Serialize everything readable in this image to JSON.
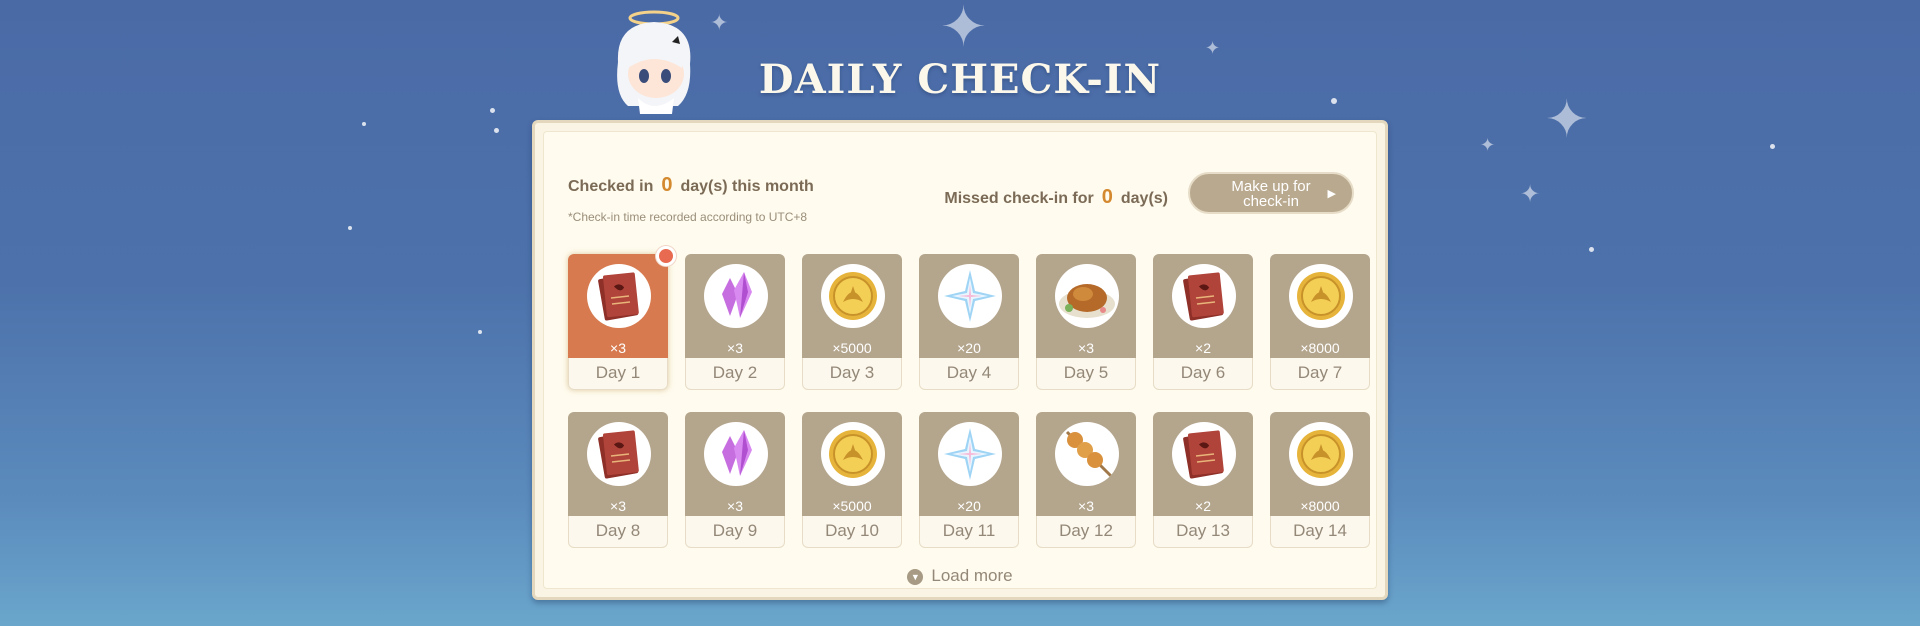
{
  "page": {
    "title": "DAILY CHECK-IN"
  },
  "stats": {
    "checked_prefix": "Checked in",
    "checked_count": "0",
    "checked_suffix": "day(s) this month",
    "note": "*Check-in time recorded according to UTC+8",
    "missed_prefix": "Missed check-in for",
    "missed_count": "0",
    "missed_suffix": "day(s)"
  },
  "makeup_button": {
    "line1": "Make up for",
    "line2": "check-in",
    "arrow": "▶"
  },
  "rewards": [
    {
      "day": "Day 1",
      "qty": "×3",
      "icon": "book-icon",
      "active": true
    },
    {
      "day": "Day 2",
      "qty": "×3",
      "icon": "crystal-icon"
    },
    {
      "day": "Day 3",
      "qty": "×5000",
      "icon": "coin-icon"
    },
    {
      "day": "Day 4",
      "qty": "×20",
      "icon": "star-gem-icon"
    },
    {
      "day": "Day 5",
      "qty": "×3",
      "icon": "roast-chicken-icon"
    },
    {
      "day": "Day 6",
      "qty": "×2",
      "icon": "book-icon"
    },
    {
      "day": "Day 7",
      "qty": "×8000",
      "icon": "coin-icon"
    },
    {
      "day": "Day 8",
      "qty": "×3",
      "icon": "book-icon"
    },
    {
      "day": "Day 9",
      "qty": "×3",
      "icon": "crystal-icon"
    },
    {
      "day": "Day 10",
      "qty": "×5000",
      "icon": "coin-icon"
    },
    {
      "day": "Day 11",
      "qty": "×20",
      "icon": "star-gem-icon"
    },
    {
      "day": "Day 12",
      "qty": "×3",
      "icon": "skewer-icon"
    },
    {
      "day": "Day 13",
      "qty": "×2",
      "icon": "book-icon"
    },
    {
      "day": "Day 14",
      "qty": "×8000",
      "icon": "coin-icon"
    }
  ],
  "load_more": {
    "label": "Load more",
    "icon": "chevron-down-icon"
  },
  "colors": {
    "accent": "#d4892f",
    "active_card": "#d77a4f",
    "card": "#b4a58d",
    "badge": "#e86a50"
  }
}
